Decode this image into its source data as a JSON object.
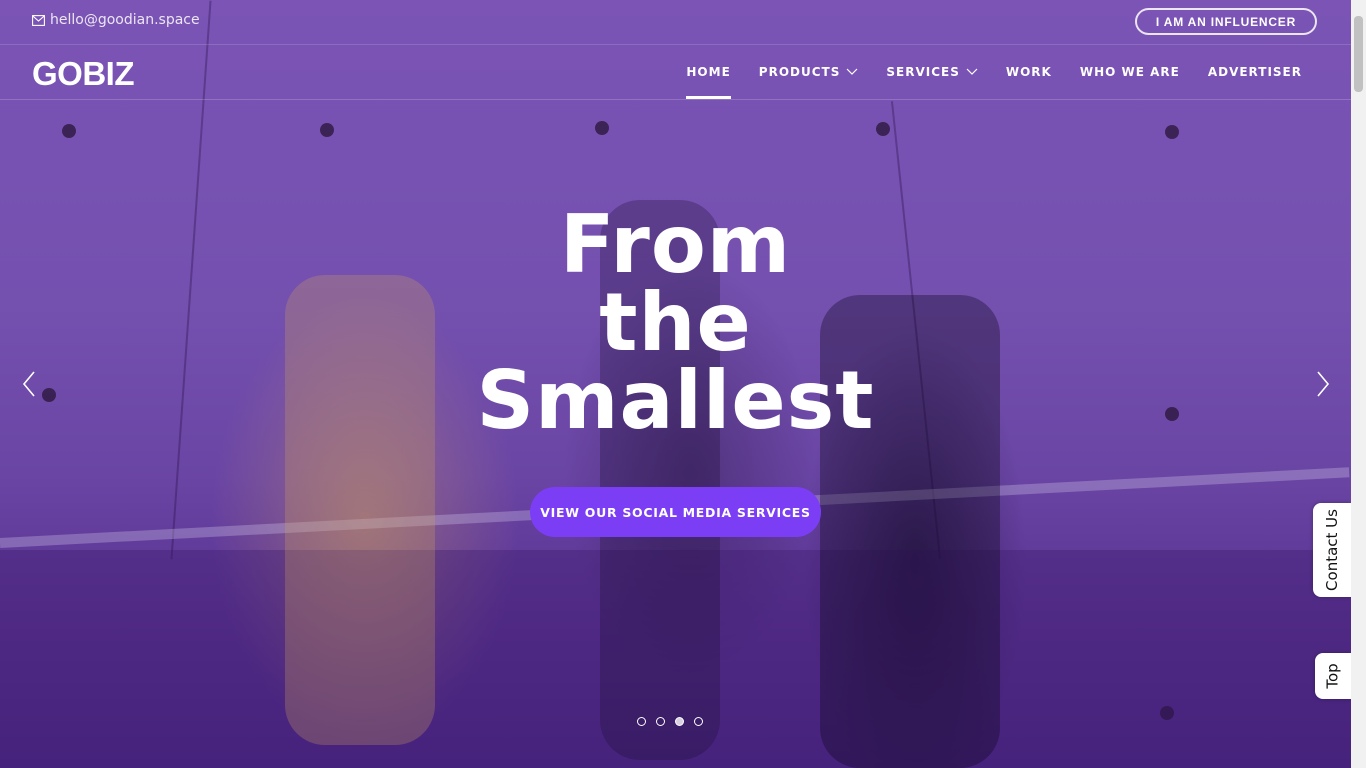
{
  "topbar": {
    "email": "hello@goodian.space",
    "influencer_button": "I AM AN INFLUENCER"
  },
  "navbar": {
    "logo": "GOBIZ",
    "items": [
      {
        "label": "HOME",
        "active": true,
        "dropdown": false
      },
      {
        "label": "PRODUCTS",
        "active": false,
        "dropdown": true
      },
      {
        "label": "SERVICES",
        "active": false,
        "dropdown": true
      },
      {
        "label": "WORK",
        "active": false,
        "dropdown": false
      },
      {
        "label": "WHO WE ARE",
        "active": false,
        "dropdown": false
      },
      {
        "label": "ADVERTISER",
        "active": false,
        "dropdown": false
      }
    ]
  },
  "hero": {
    "headline_lines": [
      "From",
      "the",
      "Smallest"
    ],
    "cta": "VIEW OUR SOCIAL MEDIA SERVICES",
    "slides_count": 4,
    "active_slide": 3,
    "overlay_color": "#6f48ad",
    "cta_color": "#7b3ef5"
  },
  "side_tabs": {
    "contact": "Contact Us",
    "top": "Top"
  },
  "icons": {
    "email": "envelope-icon",
    "prev": "chevron-left-icon",
    "next": "chevron-right-icon",
    "dropdown": "chevron-down-icon"
  }
}
